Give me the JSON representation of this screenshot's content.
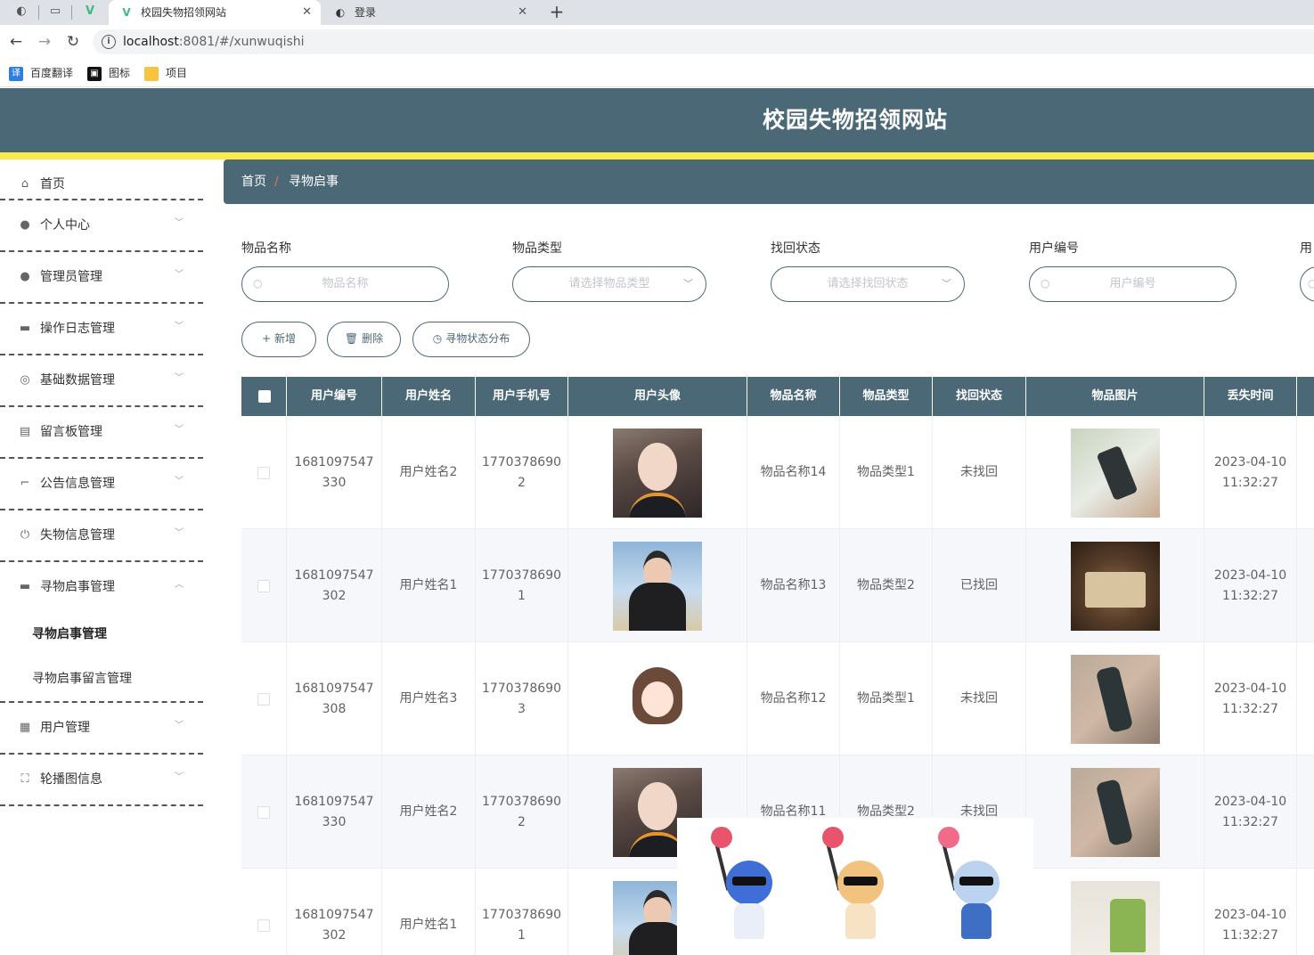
{
  "browser": {
    "tabs": [
      {
        "title": "校园失物招领网站",
        "active": true
      },
      {
        "title": "登录",
        "active": false
      }
    ],
    "url_host": "localhost",
    "url_rest": ":8081/#/xunwuqishi",
    "bookmarks": [
      "百度翻译",
      "图标",
      "项目"
    ]
  },
  "app": {
    "title": "校园失物招领网站",
    "colors": {
      "primary": "#4b6877",
      "accent_stripe": "#f9eb4c",
      "breadcrumb_sep": "#f56c4d"
    }
  },
  "sidebar": {
    "items": [
      {
        "label": "首页",
        "icon": "home-icon"
      },
      {
        "label": "个人中心",
        "icon": "user-icon"
      },
      {
        "label": "管理员管理",
        "icon": "user-icon"
      },
      {
        "label": "操作日志管理",
        "icon": "briefcase-icon"
      },
      {
        "label": "基础数据管理",
        "icon": "compass-icon"
      },
      {
        "label": "留言板管理",
        "icon": "clipboard-icon"
      },
      {
        "label": "公告信息管理",
        "icon": "crop-icon"
      },
      {
        "label": "失物信息管理",
        "icon": "power-icon"
      },
      {
        "label": "寻物启事管理",
        "icon": "monitor-icon",
        "expanded": true
      },
      {
        "label": "用户管理",
        "icon": "grid-icon"
      },
      {
        "label": "轮播图信息",
        "icon": "fullscreen-icon"
      }
    ],
    "submenu": [
      "寻物启事管理",
      "寻物启事留言管理"
    ]
  },
  "breadcrumb": {
    "home": "首页",
    "separator": "/",
    "current": "寻物启事"
  },
  "search": {
    "fields": [
      {
        "label": "物品名称",
        "placeholder": "物品名称",
        "type": "text"
      },
      {
        "label": "物品类型",
        "placeholder": "请选择物品类型",
        "type": "select"
      },
      {
        "label": "找回状态",
        "placeholder": "请选择找回状态",
        "type": "select"
      },
      {
        "label": "用户编号",
        "placeholder": "用户编号",
        "type": "text"
      },
      {
        "label": "用",
        "placeholder": "",
        "type": "text"
      }
    ]
  },
  "actions": {
    "add": "新增",
    "delete": "删除",
    "chart": "寻物状态分布"
  },
  "table": {
    "headers": [
      "用户编号",
      "用户姓名",
      "用户手机号",
      "用户头像",
      "物品名称",
      "物品类型",
      "找回状态",
      "物品图片",
      "丢失时间"
    ],
    "rows": [
      {
        "user_no_1": "1681097547",
        "user_no_2": "330",
        "name": "用户姓名2",
        "phone_1": "1770378690",
        "phone_2": "2",
        "avatar": "avatar-girl",
        "item": "物品名称14",
        "type": "物品类型1",
        "status": "未找回",
        "picture": "item-phone-hand",
        "date": "2023-04-10",
        "time": "11:32:27"
      },
      {
        "user_no_1": "1681097547",
        "user_no_2": "302",
        "name": "用户姓名1",
        "phone_1": "1770378690",
        "phone_2": "1",
        "avatar": "avatar-boy",
        "item": "物品名称13",
        "type": "物品类型2",
        "status": "已找回",
        "picture": "item-book",
        "date": "2023-04-10",
        "time": "11:32:27"
      },
      {
        "user_no_1": "1681097547",
        "user_no_2": "308",
        "name": "用户姓名3",
        "phone_1": "1770378690",
        "phone_2": "3",
        "avatar": "avatar-anime",
        "item": "物品名称12",
        "type": "物品类型1",
        "status": "未找回",
        "picture": "item-oldphone",
        "date": "2023-04-10",
        "time": "11:32:27"
      },
      {
        "user_no_1": "1681097547",
        "user_no_2": "330",
        "name": "用户姓名2",
        "phone_1": "1770378690",
        "phone_2": "2",
        "avatar": "avatar-girl",
        "item": "物品名称11",
        "type": "物品类型2",
        "status": "未找回",
        "picture": "item-oldphone",
        "date": "2023-04-10",
        "time": "11:32:27"
      },
      {
        "user_no_1": "1681097547",
        "user_no_2": "302",
        "name": "用户姓名1",
        "phone_1": "1770378690",
        "phone_2": "1",
        "avatar": "avatar-boy",
        "item": "",
        "type": "",
        "status": "",
        "picture": "item-shirts",
        "date": "2023-04-10",
        "time": "11:32:27"
      }
    ]
  }
}
